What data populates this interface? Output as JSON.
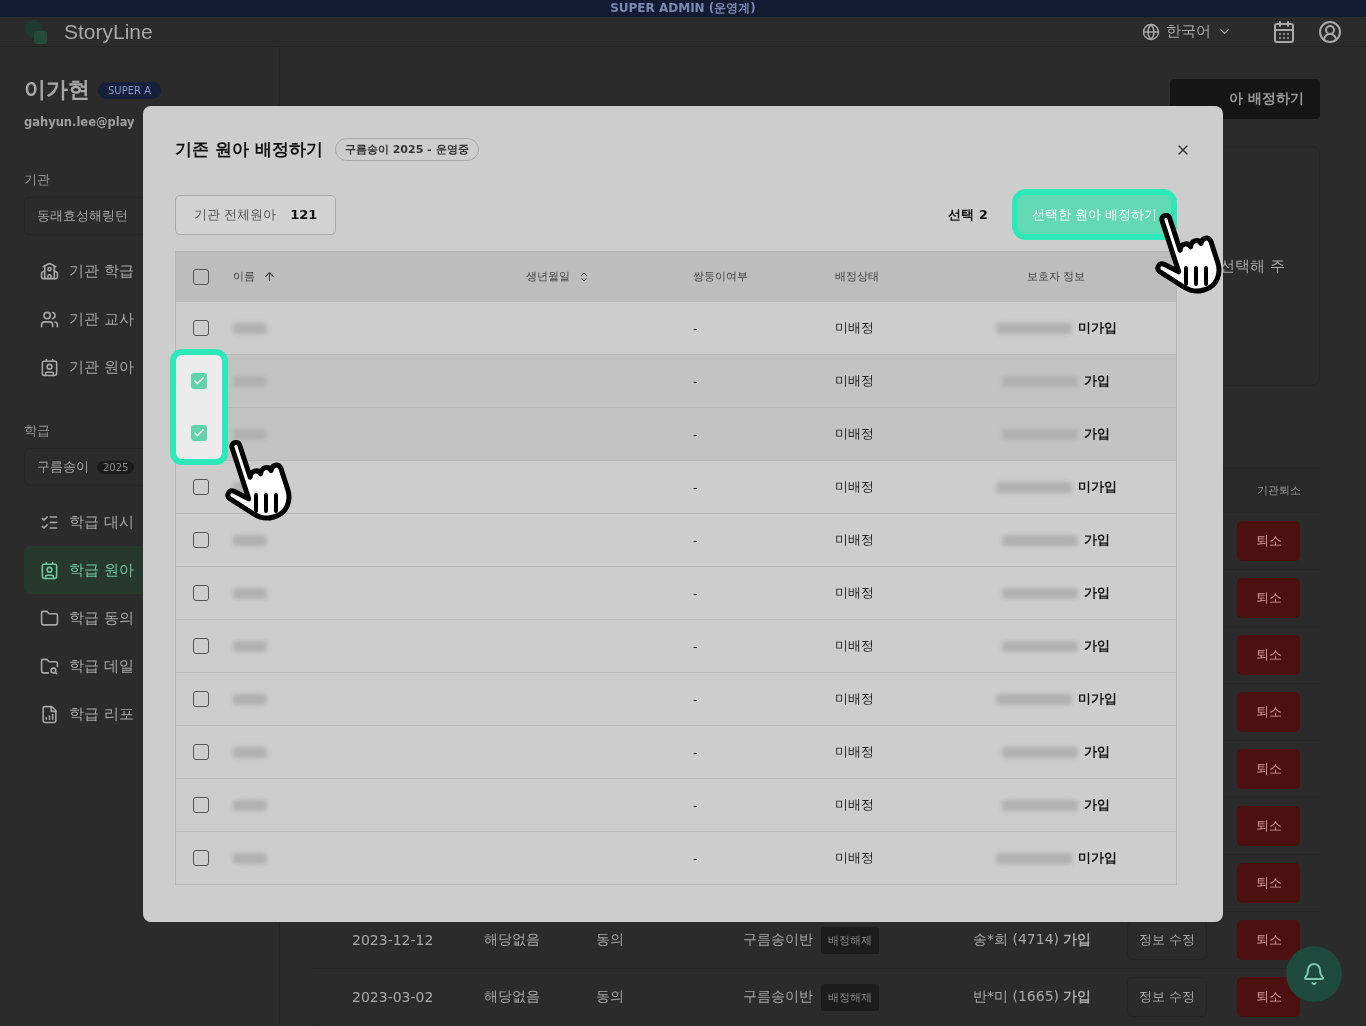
{
  "banner": {
    "text": "SUPER ADMIN (운영계)"
  },
  "header": {
    "logo": "StoryLine",
    "language": "한국어"
  },
  "sidebar": {
    "user_name": "이가현",
    "role_badge": "SUPER A",
    "email": "gahyun.lee@play",
    "org_label": "기관",
    "org_value": "동래효성해링턴",
    "org_items": [
      {
        "label": "기관 학급",
        "selected": false
      },
      {
        "label": "기관 교사",
        "selected": false
      },
      {
        "label": "기관 원아",
        "selected": false
      }
    ],
    "class_label": "학급",
    "class_value": "구름송이",
    "class_year": "2025",
    "class_items": [
      {
        "label": "학급 대시",
        "selected": false
      },
      {
        "label": "학급 원아",
        "selected": true
      },
      {
        "label": "학급 동의",
        "selected": false
      },
      {
        "label": "학급 데일",
        "selected": false
      },
      {
        "label": "학급 리포",
        "selected": false
      }
    ]
  },
  "background": {
    "assign_button": "아 배정하기",
    "hint": "선택해 주",
    "withdraw_header": "기관퇴소",
    "rows": [
      {
        "withdraw": "퇴소"
      },
      {
        "withdraw": "퇴소"
      },
      {
        "withdraw": "퇴소"
      },
      {
        "withdraw": "퇴소"
      },
      {
        "withdraw": "퇴소"
      },
      {
        "withdraw": "퇴소"
      },
      {
        "withdraw": "퇴소"
      },
      {
        "birth": "2023-12-12",
        "twin": "해당없음",
        "consent": "동의",
        "class": "구름송이반",
        "unassign": "배정해제",
        "guardian": "송*희 (4714) **가입**",
        "edit": "정보 수정",
        "withdraw": "퇴소"
      },
      {
        "birth": "2023-03-02",
        "twin": "해당없음",
        "consent": "동의",
        "class": "구름송이반",
        "unassign": "배정해제",
        "guardian": "반*미 (1665) **가입**",
        "edit": "정보 수정",
        "withdraw": "퇴소"
      }
    ]
  },
  "modal": {
    "title": "기존 원아 배정하기",
    "chip": "구름송이 2025 - 운영중",
    "total_label": "기관 전체원아",
    "total_count": "121",
    "selection": "선택 2",
    "assign_button": "선택한 원아 배정하기",
    "all_checked": false,
    "columns": [
      {
        "label": "이름"
      },
      {
        "label": "생년월일"
      },
      {
        "label": "쌍둥이여부"
      },
      {
        "label": "배정상태"
      },
      {
        "label": "보호자 정보"
      }
    ],
    "rows": [
      {
        "checked": false,
        "twin": "-",
        "assignment": "미배정",
        "guardian_status": "미가입"
      },
      {
        "checked": true,
        "twin": "-",
        "assignment": "미배정",
        "guardian_status": "가입"
      },
      {
        "checked": true,
        "twin": "-",
        "assignment": "미배정",
        "guardian_status": "가입"
      },
      {
        "checked": false,
        "twin": "-",
        "assignment": "미배정",
        "guardian_status": "미가입"
      },
      {
        "checked": false,
        "twin": "-",
        "assignment": "미배정",
        "guardian_status": "가입"
      },
      {
        "checked": false,
        "twin": "-",
        "assignment": "미배정",
        "guardian_status": "가입"
      },
      {
        "checked": false,
        "twin": "-",
        "assignment": "미배정",
        "guardian_status": "가입"
      },
      {
        "checked": false,
        "twin": "-",
        "assignment": "미배정",
        "guardian_status": "미가입"
      },
      {
        "checked": false,
        "twin": "-",
        "assignment": "미배정",
        "guardian_status": "가입"
      },
      {
        "checked": false,
        "twin": "-",
        "assignment": "미배정",
        "guardian_status": "가입"
      },
      {
        "checked": false,
        "twin": "-",
        "assignment": "미배정",
        "guardian_status": "미가입"
      }
    ]
  }
}
